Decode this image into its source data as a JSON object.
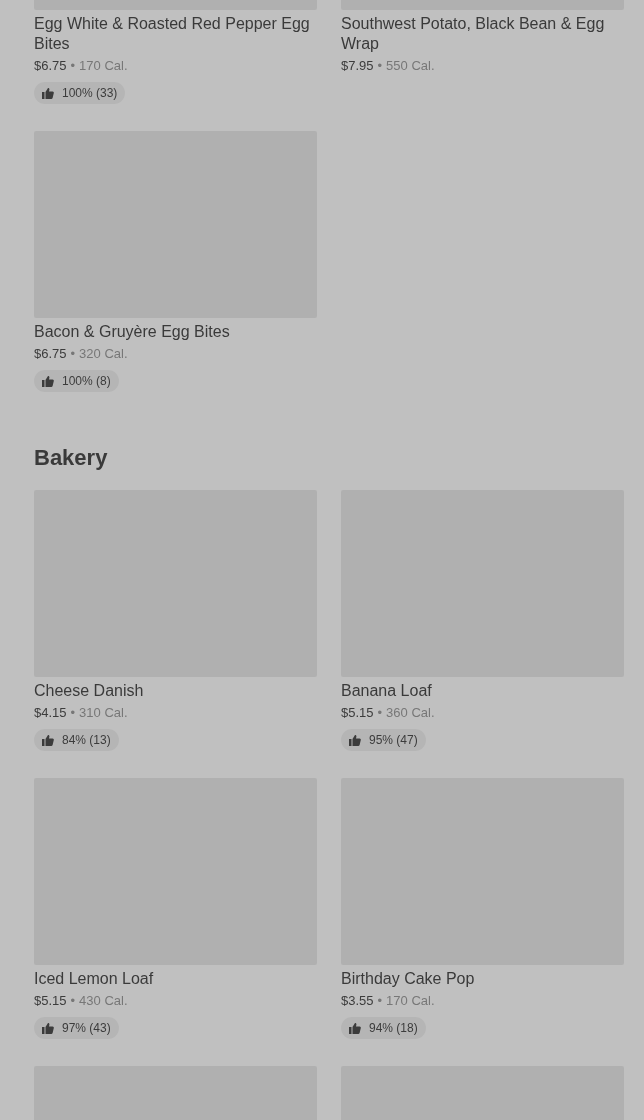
{
  "sections": [
    {
      "items": [
        {
          "kind": "item",
          "name": "Egg White & Roasted Red Pepper Egg Bites",
          "price": "$6.75",
          "separator": "•",
          "calories": "170 Cal.",
          "rating": "100% (33)"
        },
        {
          "kind": "item",
          "name": "Southwest Potato, Black Bean & Egg Wrap",
          "price": "$7.95",
          "separator": "•",
          "calories": "550 Cal."
        },
        {
          "kind": "item",
          "name": "Bacon & Gruyère Egg Bites",
          "price": "$6.75",
          "separator": "•",
          "calories": "320 Cal.",
          "rating": "100% (8)"
        }
      ]
    },
    {
      "title": "Bakery",
      "items": [
        {
          "kind": "item",
          "name": "Cheese Danish",
          "price": "$4.15",
          "separator": "•",
          "calories": "310 Cal.",
          "rating": "84% (13)"
        },
        {
          "kind": "item",
          "name": "Banana Loaf",
          "price": "$5.15",
          "separator": "•",
          "calories": "360 Cal.",
          "rating": "95% (47)"
        },
        {
          "kind": "item",
          "name": "Iced Lemon Loaf",
          "price": "$5.15",
          "separator": "•",
          "calories": "430 Cal.",
          "rating": "97% (43)"
        },
        {
          "kind": "item",
          "name": "Birthday Cake Pop",
          "price": "$3.55",
          "separator": "•",
          "calories": "170 Cal.",
          "rating": "94% (18)"
        },
        {
          "kind": "image-only"
        },
        {
          "kind": "image-only"
        }
      ]
    }
  ]
}
